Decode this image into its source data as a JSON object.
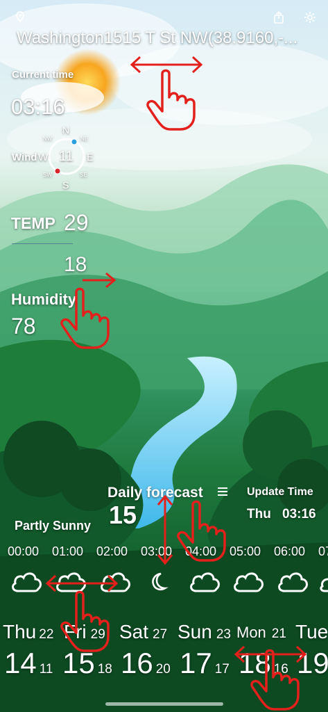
{
  "header": {
    "location": "Washington1515 T St NW(38.9160,-...",
    "location_icon": "location-pin-icon",
    "share_icon": "share-icon",
    "settings_icon": "gear-icon"
  },
  "current_time": {
    "label": "Current time",
    "value": "03:16"
  },
  "wind": {
    "label": "Wind",
    "direction_w": "W",
    "speed": "11",
    "compass": {
      "N": "N",
      "NE": "NE",
      "E": "E",
      "SE": "SE",
      "S": "S",
      "SW": "SW",
      "NW": "NW"
    }
  },
  "temp": {
    "label": "TEMP",
    "high": "29",
    "low": "18"
  },
  "humidity": {
    "label": "Humidity",
    "value": "78"
  },
  "daily_forecast": {
    "label": "Daily forecast",
    "value": "15",
    "menu_icon": "hamburger-menu-icon"
  },
  "update": {
    "label": "Update Time",
    "day": "Thu",
    "time": "03:16"
  },
  "condition": "Partly Sunny",
  "hourly": [
    {
      "time": "00:00",
      "icon": "cloud-icon"
    },
    {
      "time": "01:00",
      "icon": "cloud-icon"
    },
    {
      "time": "02:00",
      "icon": "cloud-icon"
    },
    {
      "time": "03:00",
      "icon": "moon-icon"
    },
    {
      "time": "04:00",
      "icon": "cloud-icon"
    },
    {
      "time": "05:00",
      "icon": "cloud-icon"
    },
    {
      "time": "06:00",
      "icon": "cloud-icon"
    },
    {
      "time": "07",
      "icon": "cloud-icon"
    }
  ],
  "daily": [
    {
      "day": "Thu",
      "date": "22",
      "high": "14",
      "low": "11"
    },
    {
      "day": "Fri",
      "date": "29",
      "high": "15",
      "low": "18"
    },
    {
      "day": "Sat",
      "date": "27",
      "high": "16",
      "low": "20"
    },
    {
      "day": "Sun",
      "date": "23",
      "high": "17",
      "low": "17"
    },
    {
      "day": "Mon",
      "date": "21",
      "high": "18",
      "low": "16"
    },
    {
      "day": "Tue",
      "date": "",
      "high": "19",
      "low": ""
    }
  ],
  "colors": {
    "gesture_red": "#e3201b",
    "compass_ne_dot": "#2a9fe0",
    "compass_sw_dot": "#d9232b"
  }
}
